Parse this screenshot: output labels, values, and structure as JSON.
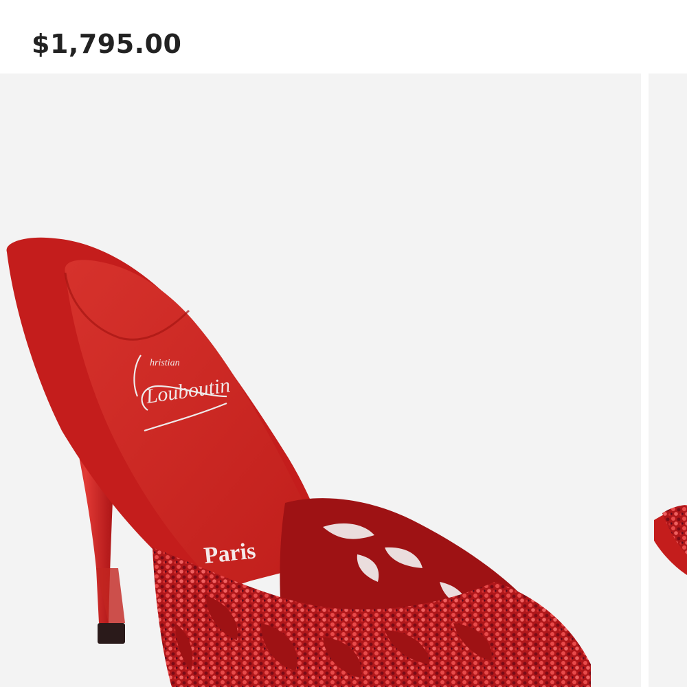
{
  "product": {
    "price": "$1,795.00",
    "brand_logo_text": [
      "hristian",
      "Louboutin"
    ],
    "insole_text": "Paris"
  },
  "gallery": {
    "main_image": "red-crystal-mule-photo",
    "next_image": "red-crystal-mule-photo-partial"
  },
  "colors": {
    "price_text": "#222222",
    "image_bg": "#f3f3f3",
    "shoe_red": "#cc1c1c"
  }
}
